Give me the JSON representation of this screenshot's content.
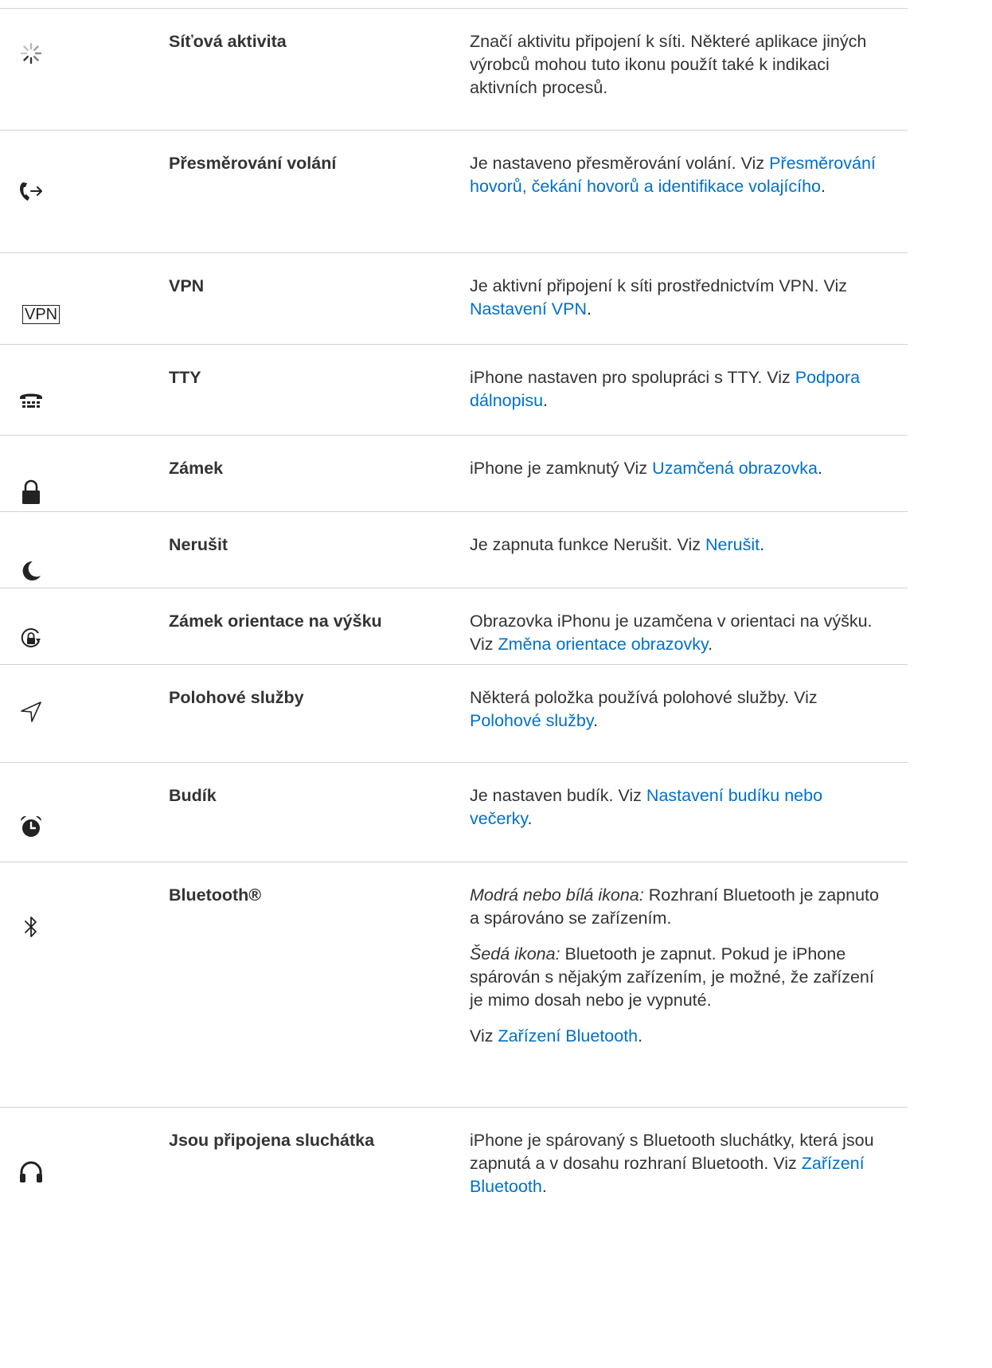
{
  "rows": [
    {
      "icon": "network-activity-icon",
      "name": "Síťová aktivita",
      "desc": [
        {
          "parts": [
            {
              "t": "Značí aktivitu připojení k síti. Některé aplikace jiných výrobců mohou tuto ikonu použít také k indikaci aktivních procesů."
            }
          ]
        }
      ]
    },
    {
      "icon": "call-forwarding-icon",
      "name": "Přesměrování volání",
      "desc": [
        {
          "parts": [
            {
              "t": "Je nastaveno přesměrování volání. Viz "
            },
            {
              "t": "Přesměrování hovorů, čekání hovorů a identifikace volajícího",
              "link": true
            },
            {
              "t": "."
            }
          ]
        }
      ]
    },
    {
      "icon": "vpn-icon",
      "icon_text": "VPN",
      "name": "VPN",
      "desc": [
        {
          "parts": [
            {
              "t": "Je aktivní připojení k síti prostřednictvím VPN. Viz "
            },
            {
              "t": "Nastavení VPN",
              "link": true
            },
            {
              "t": "."
            }
          ]
        }
      ]
    },
    {
      "icon": "tty-icon",
      "name": "TTY",
      "desc": [
        {
          "parts": [
            {
              "t": "iPhone nastaven pro spolupráci s TTY. Viz "
            },
            {
              "t": "Podpora dálnopisu",
              "link": true
            },
            {
              "t": "."
            }
          ]
        }
      ]
    },
    {
      "icon": "lock-icon",
      "name": "Zámek",
      "desc": [
        {
          "parts": [
            {
              "t": "iPhone je zamknutý Viz "
            },
            {
              "t": "Uzamčená obrazovka",
              "link": true
            },
            {
              "t": "."
            }
          ]
        }
      ]
    },
    {
      "icon": "moon-icon",
      "name": "Nerušit",
      "desc": [
        {
          "parts": [
            {
              "t": "Je zapnuta funkce Nerušit. Viz "
            },
            {
              "t": "Nerušit",
              "link": true
            },
            {
              "t": "."
            }
          ]
        }
      ]
    },
    {
      "icon": "portrait-lock-icon",
      "name": "Zámek orientace na výšku",
      "desc": [
        {
          "parts": [
            {
              "t": "Obrazovka iPhonu je uzamčena v orientaci na výšku. Viz "
            },
            {
              "t": "Změna orientace obrazovky",
              "link": true
            },
            {
              "t": "."
            }
          ]
        }
      ]
    },
    {
      "icon": "location-arrow-icon",
      "name": "Polohové služby",
      "desc": [
        {
          "parts": [
            {
              "t": "Některá položka používá polohové služby. Viz "
            },
            {
              "t": "Polohové služby",
              "link": true
            },
            {
              "t": "."
            }
          ]
        }
      ]
    },
    {
      "icon": "alarm-clock-icon",
      "name": "Budík",
      "desc": [
        {
          "parts": [
            {
              "t": "Je nastaven budík. Viz "
            },
            {
              "t": "Nastavení budíku nebo večerky",
              "link": true
            },
            {
              "t": "."
            }
          ]
        }
      ]
    },
    {
      "icon": "bluetooth-icon",
      "name": "Bluetooth®",
      "desc": [
        {
          "parts": [
            {
              "t": "Modrá nebo bílá ikona:",
              "em": true
            },
            {
              "t": " Rozhraní Bluetooth je zapnuto a spárováno se zařízením."
            }
          ]
        },
        {
          "parts": [
            {
              "t": "Šedá ikona:",
              "em": true
            },
            {
              "t": " Bluetooth je zapnut. Pokud je iPhone spárován s nějakým zařízením, je možné, že zařízení je mimo dosah nebo je vypnuté."
            }
          ]
        },
        {
          "parts": [
            {
              "t": "Viz "
            },
            {
              "t": "Zařízení Bluetooth",
              "link": true
            },
            {
              "t": "."
            }
          ]
        }
      ]
    },
    {
      "icon": "headphones-icon",
      "name": "Jsou připojena sluchátka",
      "desc": [
        {
          "parts": [
            {
              "t": "iPhone je spárovaný s Bluetooth sluchátky, která jsou zapnutá a v dosahu rozhraní Bluetooth. Viz "
            },
            {
              "t": "Zařízení Bluetooth",
              "link": true
            },
            {
              "t": "."
            }
          ]
        }
      ]
    }
  ]
}
